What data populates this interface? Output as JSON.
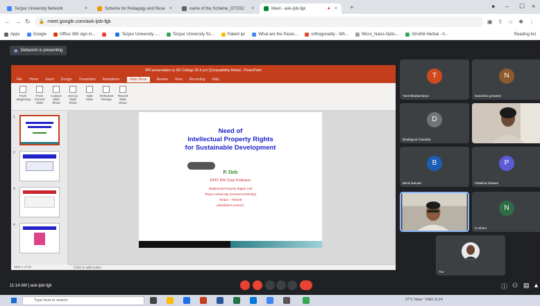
{
  "browser": {
    "tabs": [
      {
        "label": "Tezpur University Network",
        "fav": "#4285f4"
      },
      {
        "label": "Scheme for Pedagogy and Rese",
        "fav": "#f29900"
      },
      {
        "label": "name of the Scheme_GTSSC",
        "fav": "#5f6368"
      },
      {
        "label": "Meet - aok-ijsb-fgk",
        "fav": "#00832d",
        "active": true
      }
    ],
    "url": "meet.google.com/aok-ijsb-fgk",
    "bookmarks": [
      {
        "label": "Apps",
        "color": "#5f6368"
      },
      {
        "label": "Google",
        "color": "#4285f4"
      },
      {
        "label": "Office 365 sign in...",
        "color": "#d83b01"
      },
      {
        "label": "",
        "color": "#ea4335"
      },
      {
        "label": "Tezpur University -...",
        "color": "#1a73e8"
      },
      {
        "label": "Tezpur University Sc...",
        "color": "#34a853"
      },
      {
        "label": "Patent ipr",
        "color": "#fbbc04"
      },
      {
        "label": "What are the Paren...",
        "color": "#4285f4"
      },
      {
        "label": "orthogonality - Wh...",
        "color": "#ea4335"
      },
      {
        "label": "Micro_Nano-Optic...",
        "color": "#9aa0a6"
      },
      {
        "label": "Ornithil-Herbal - h...",
        "color": "#34a853"
      }
    ],
    "reading_list": "Reading list"
  },
  "meet": {
    "presenting_banner": "Debasish is presenting",
    "meeting_code": "11:14 AM | aok-ijsb-fgk"
  },
  "ppt": {
    "title": "IPR presentation to SD College 26-3-yrs! [Compatibility Mode] - PowerPoint",
    "menu": [
      "File",
      "Home",
      "Insert",
      "Design",
      "Transitions",
      "Animations",
      "Slide Show",
      "Review",
      "View",
      "Recording",
      "Help"
    ],
    "active_menu": "Slide Show",
    "ribbon": [
      "From Beginning",
      "From Current Slide",
      "Custom Slide Show",
      "Set Up Slide Show",
      "Hide Slide",
      "Rehearse Timings",
      "Record Slide Show"
    ],
    "notes_placeholder": "Click to add notes",
    "status": "Slide 1 of 33",
    "slide": {
      "title_1": "Need of",
      "title_2": "Intellectual Property Rights",
      "title_3": "for Sustainable Development",
      "author": "P. Deb",
      "role": "DPIIT IPR Chair Professor",
      "aff_1": "Intellectual Property Rights Cell",
      "aff_2": "Tezpur University (Central University)",
      "aff_3": "Tezpur - 784028",
      "aff_4": "pdeb@tezu.ernet.in"
    }
  },
  "participants": [
    {
      "initial": "T",
      "name": "Tutul Bhattacharya",
      "color": "#d04a1f"
    },
    {
      "initial": "N",
      "name": "Nandinita goswami",
      "color": "#8d5a2e"
    },
    {
      "initial": "D",
      "name": "Bhabajyoti Chandha",
      "color": "#70757a"
    },
    {
      "initial": "",
      "name": "",
      "video": true
    },
    {
      "initial": "B",
      "name": "Bitoni Baruah",
      "color": "#1a5fb4"
    },
    {
      "initial": "P",
      "name": "Palakhia Ishiaani",
      "color": "#5b5cd6"
    },
    {
      "initial": "",
      "name": "",
      "video": true
    },
    {
      "initial": "N",
      "name": "N others",
      "color": "#2f6d45"
    },
    {
      "initial": "",
      "name": "You",
      "video": true
    }
  ],
  "taskbar": {
    "search_placeholder": "Type here to search",
    "tray": "27°C Haze  ^  ENG  11:14"
  }
}
